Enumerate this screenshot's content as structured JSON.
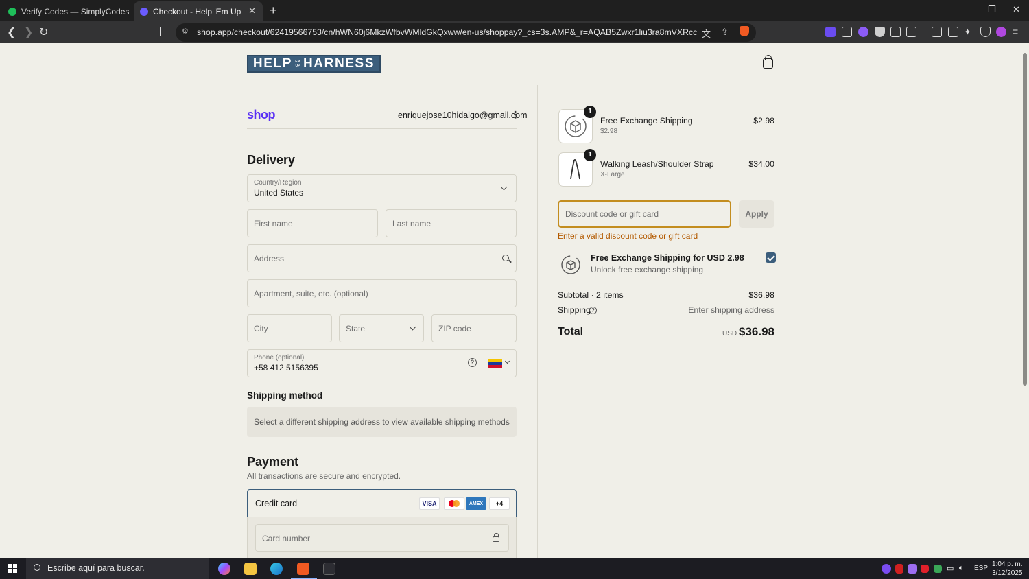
{
  "browser": {
    "tabs": [
      {
        "title": "Verify Codes — SimplyCodes",
        "active": false
      },
      {
        "title": "Checkout - Help 'Em Up",
        "active": true
      }
    ],
    "url": "shop.app/checkout/62419566753/cn/hWN60j6MkzWfbvWMldGkQxww/en-us/shoppay?_cs=3s.AMP&_r=AQAB5Zwxr1liu3ra8mVXRccBMel4KBZDH3v..."
  },
  "store": {
    "logo_text_left": "HELP",
    "logo_text_small": "EM UP",
    "logo_text_right": "HARNESS"
  },
  "account": {
    "shop_label": "shop",
    "email": "enriquejose10hidalgo@gmail.com"
  },
  "delivery": {
    "title": "Delivery",
    "country_label": "Country/Region",
    "country_value": "United States",
    "first_name_ph": "First name",
    "last_name_ph": "Last name",
    "address_ph": "Address",
    "apartment_ph": "Apartment, suite, etc. (optional)",
    "city_ph": "City",
    "state_ph": "State",
    "zip_ph": "ZIP code",
    "phone_label": "Phone (optional)",
    "phone_value": "+58 412 5156395"
  },
  "shipping_method": {
    "title": "Shipping method",
    "message": "Select a different shipping address to view available shipping methods"
  },
  "payment": {
    "title": "Payment",
    "subtitle": "All transactions are secure and encrypted.",
    "method_label": "Credit card",
    "cards": [
      "VISA",
      "",
      "AMEX",
      "+4"
    ],
    "card_number_ph": "Card number"
  },
  "order": {
    "items": [
      {
        "qty": "1",
        "name": "Free Exchange Shipping",
        "variant": "$2.98",
        "price": "$2.98"
      },
      {
        "qty": "1",
        "name": "Walking Leash/Shoulder Strap",
        "variant": "X-Large",
        "price": "$34.00"
      }
    ],
    "discount_ph": "Discount code or gift card",
    "apply_label": "Apply",
    "discount_error": "Enter a valid discount code or gift card",
    "upsell_title": "Free Exchange Shipping for USD 2.98",
    "upsell_sub": "Unlock free exchange shipping",
    "subtotal_label": "Subtotal · 2 items",
    "subtotal_value": "$36.98",
    "shipping_label": "Shipping",
    "shipping_value": "Enter shipping address",
    "total_label": "Total",
    "total_currency": "USD",
    "total_value": "$36.98"
  },
  "taskbar": {
    "search_ph": "Escribe aquí para buscar.",
    "lang": "ESP",
    "time": "1:04 p. m.",
    "date": "3/12/2025"
  },
  "colors": {
    "accent": "#3c5e7c",
    "error": "#b35a00",
    "focus_border": "#c38d1f",
    "shop_purple": "#5a31f4"
  }
}
